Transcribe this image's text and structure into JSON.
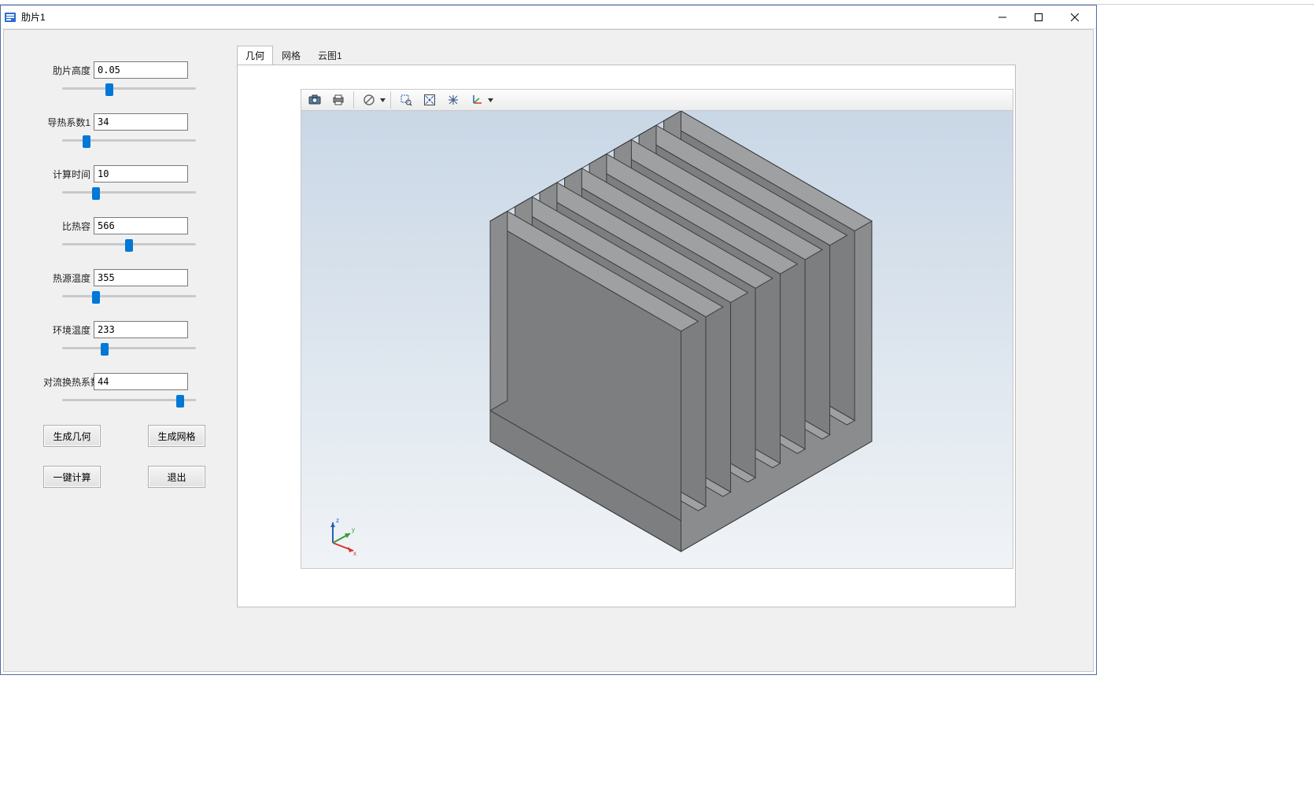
{
  "window": {
    "title": "肋片1"
  },
  "params": [
    {
      "label": "肋片高度",
      "value": "0.05",
      "slider_pct": 35
    },
    {
      "label": "导热系数1",
      "value": "34",
      "slider_pct": 18
    },
    {
      "label": "计算时间",
      "value": "10",
      "slider_pct": 25
    },
    {
      "label": "比热容",
      "value": "566",
      "slider_pct": 50
    },
    {
      "label": "热源温度",
      "value": "355",
      "slider_pct": 25
    },
    {
      "label": "环境温度",
      "value": "233",
      "slider_pct": 32
    },
    {
      "label": "对流换热系数",
      "value": "44",
      "slider_pct": 88
    }
  ],
  "buttons": {
    "gen_geom": "生成几何",
    "gen_mesh": "生成网格",
    "one_click": "一键计算",
    "exit": "退出"
  },
  "tabs": [
    {
      "label": "几何",
      "active": true
    },
    {
      "label": "网格",
      "active": false
    },
    {
      "label": "云图1",
      "active": false
    }
  ],
  "triad": {
    "x": "x",
    "y": "y",
    "z": "z"
  },
  "toolbar_icons": [
    "camera-icon",
    "printer-icon",
    "|",
    "no-symbol-icon",
    "caret",
    "|",
    "zoom-selection-icon",
    "fit-view-icon",
    "reset-zoom-icon",
    "axes-icon",
    "caret"
  ],
  "colors": {
    "accent": "#0078d7",
    "fin_face": "#8a8c8d",
    "fin_top": "#9ea0a1",
    "fin_side": "#7c7e7f",
    "triad_x": "#d6322c",
    "triad_y": "#3a9b35",
    "triad_z": "#2a5fb4"
  }
}
